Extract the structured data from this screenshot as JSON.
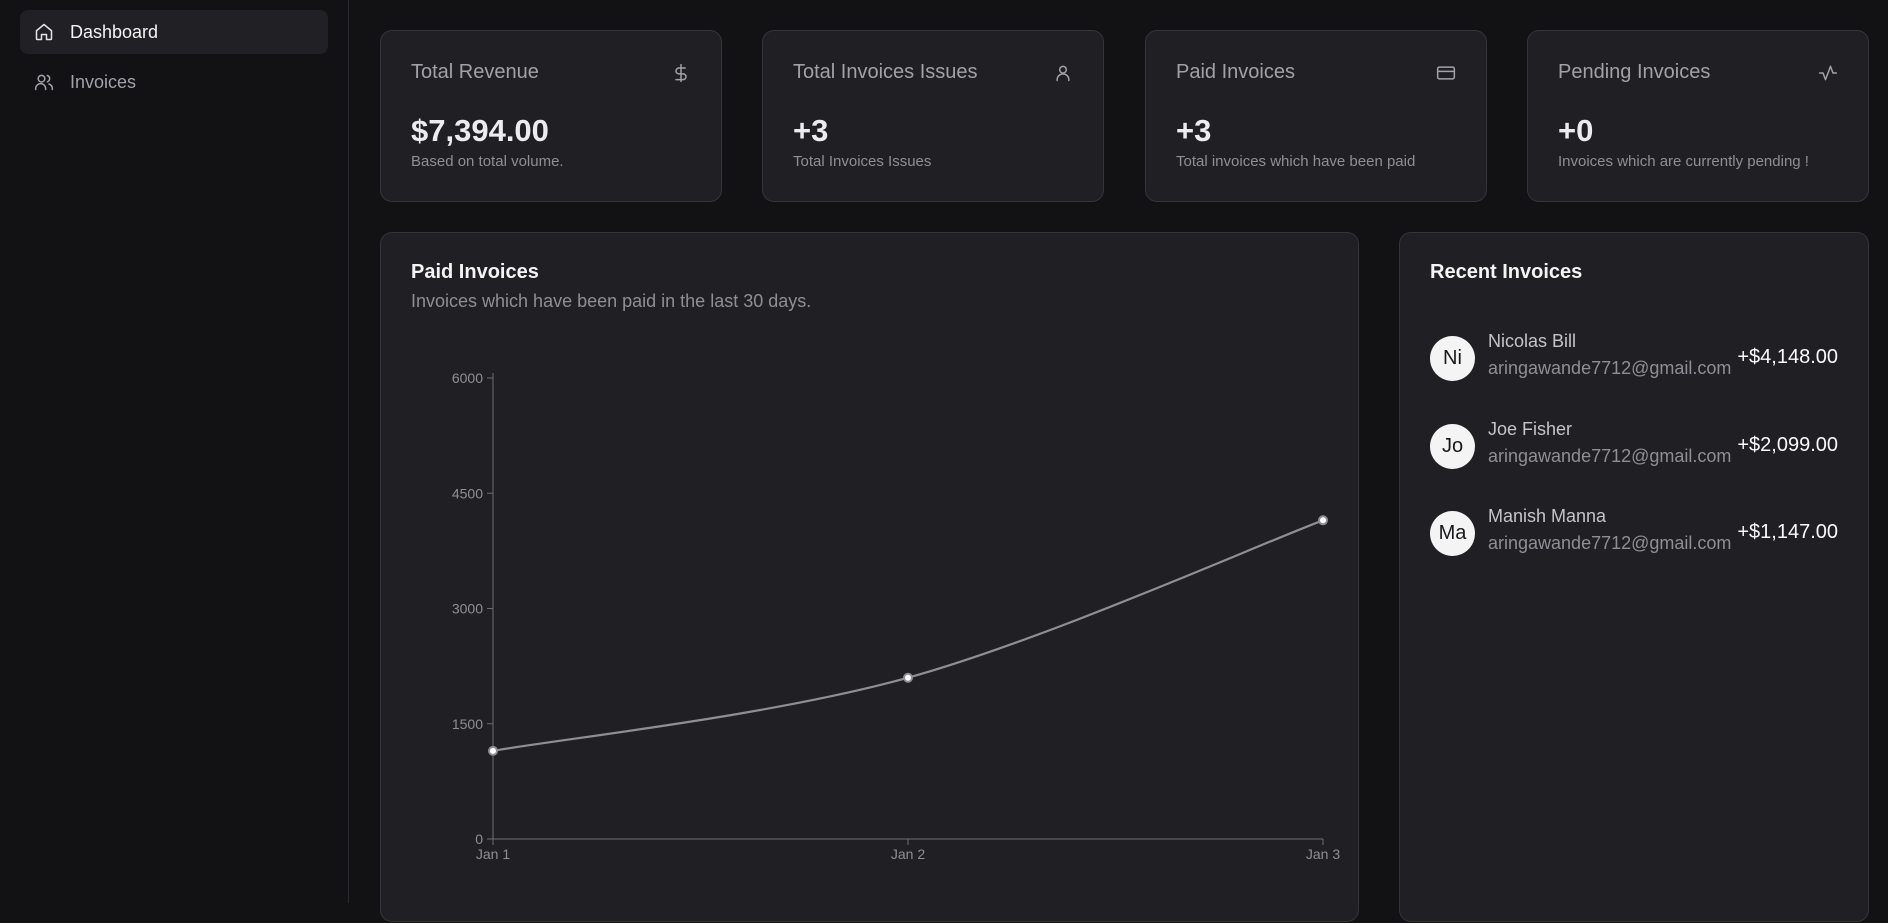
{
  "sidebar": {
    "items": [
      {
        "label": "Dashboard",
        "icon": "home-icon",
        "active": true
      },
      {
        "label": "Invoices",
        "icon": "users-icon",
        "active": false
      }
    ]
  },
  "stats": [
    {
      "title": "Total Revenue",
      "value": "$7,394.00",
      "description": "Based on total volume.",
      "icon": "dollar-icon"
    },
    {
      "title": "Total Invoices Issues",
      "value": "+3",
      "description": "Total Invoices Issues",
      "icon": "user-icon"
    },
    {
      "title": "Paid Invoices",
      "value": "+3",
      "description": "Total invoices which have been paid",
      "icon": "credit-card-icon"
    },
    {
      "title": "Pending Invoices",
      "value": "+0",
      "description": "Invoices which are currently pending !",
      "icon": "activity-icon"
    }
  ],
  "paid_panel": {
    "title": "Paid Invoices",
    "subtitle": "Invoices which have been paid in the last 30 days."
  },
  "chart_data": {
    "type": "line",
    "categories": [
      "Jan 1",
      "Jan 2",
      "Jan 3"
    ],
    "values": [
      1147,
      2099,
      4148
    ],
    "ylim": [
      0,
      6000
    ],
    "yticks": [
      "0",
      "1500",
      "3000",
      "4500",
      "6000"
    ],
    "grid": false,
    "colors": {
      "line": "#8e8e96",
      "axis": "#6b6b73"
    }
  },
  "recent": {
    "title": "Recent Invoices",
    "items": [
      {
        "initials": "Ni",
        "name": "Nicolas Bill",
        "email": "aringawande7712@gmail.com",
        "amount": "+$4,148.00"
      },
      {
        "initials": "Jo",
        "name": "Joe Fisher",
        "email": "aringawande7712@gmail.com",
        "amount": "+$2,099.00"
      },
      {
        "initials": "Ma",
        "name": "Manish Manna",
        "email": "aringawande7712@gmail.com",
        "amount": "+$1,147.00"
      }
    ]
  }
}
